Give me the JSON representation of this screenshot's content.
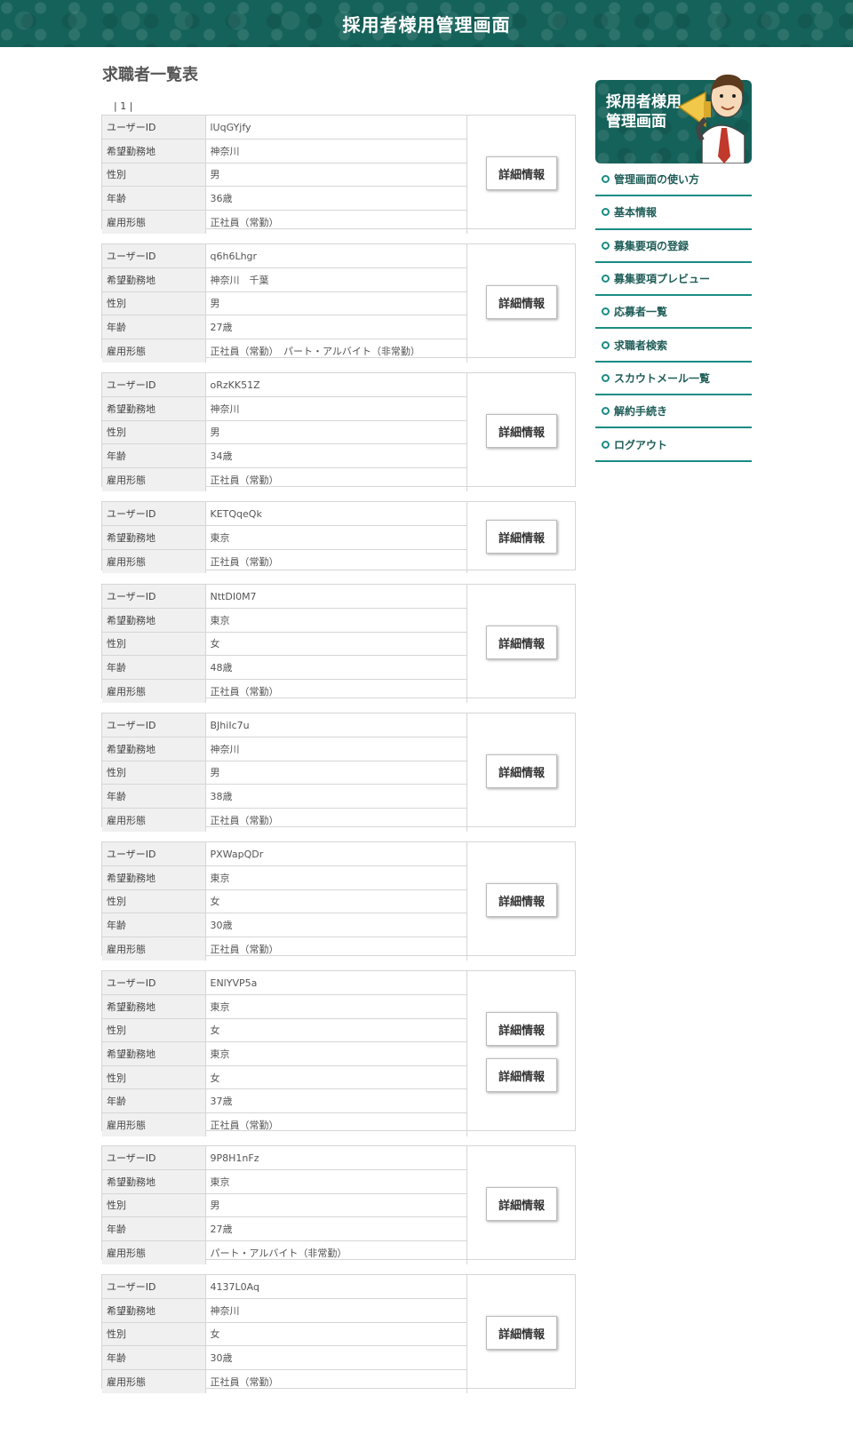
{
  "header": {
    "title": "採用者様用管理画面"
  },
  "page": {
    "heading": "求職者一覧表",
    "pagination": "| 1 |"
  },
  "detail_label": "詳細情報",
  "labels": {
    "user_id": "ユーザーID",
    "location": "希望勤務地",
    "gender": "性別",
    "age": "年齢",
    "employment": "雇用形態"
  },
  "cards": [
    {
      "rows": [
        [
          "ユーザーID",
          "lUqGYjfy"
        ],
        [
          "希望勤務地",
          "神奈川"
        ],
        [
          "性別",
          "男"
        ],
        [
          "年齢",
          "36歳"
        ],
        [
          "雇用形態",
          "正社員（常勤）"
        ]
      ]
    },
    {
      "rows": [
        [
          "ユーザーID",
          "q6h6Lhgr"
        ],
        [
          "希望勤務地",
          "神奈川　千葉"
        ],
        [
          "性別",
          "男"
        ],
        [
          "年齢",
          "27歳"
        ],
        [
          "雇用形態",
          "正社員（常勤）　パート・アルバイト（非常勤）"
        ]
      ]
    },
    {
      "rows": [
        [
          "ユーザーID",
          "oRzKK51Z"
        ],
        [
          "希望勤務地",
          "神奈川"
        ],
        [
          "性別",
          "男"
        ],
        [
          "年齢",
          "34歳"
        ],
        [
          "雇用形態",
          "正社員（常勤）"
        ]
      ]
    },
    {
      "rows": [
        [
          "ユーザーID",
          "KETQqeQk"
        ],
        [
          "希望勤務地",
          "東京"
        ],
        [
          "雇用形態",
          "正社員（常勤）"
        ]
      ]
    },
    {
      "rows": [
        [
          "ユーザーID",
          "NttDI0M7"
        ],
        [
          "希望勤務地",
          "東京"
        ],
        [
          "性別",
          "女"
        ],
        [
          "年齢",
          "48歳"
        ],
        [
          "雇用形態",
          "正社員（常勤）"
        ]
      ]
    },
    {
      "rows": [
        [
          "ユーザーID",
          "BJhiIc7u"
        ],
        [
          "希望勤務地",
          "神奈川"
        ],
        [
          "性別",
          "男"
        ],
        [
          "年齢",
          "38歳"
        ],
        [
          "雇用形態",
          "正社員（常勤）"
        ]
      ]
    },
    {
      "rows": [
        [
          "ユーザーID",
          "PXWapQDr"
        ],
        [
          "希望勤務地",
          "東京"
        ],
        [
          "性別",
          "女"
        ],
        [
          "年齢",
          "30歳"
        ],
        [
          "雇用形態",
          "正社員（常勤）"
        ]
      ]
    },
    {
      "rows": [
        [
          "ユーザーID",
          "ENlYVP5a"
        ],
        [
          "希望勤務地",
          "東京"
        ],
        [
          "性別",
          "女"
        ],
        [
          "希望勤務地",
          "東京"
        ],
        [
          "性別",
          "女"
        ],
        [
          "年齢",
          "37歳"
        ],
        [
          "雇用形態",
          "正社員（常勤）"
        ]
      ]
    },
    {
      "rows": [
        [
          "ユーザーID",
          "9P8H1nFz"
        ],
        [
          "希望勤務地",
          "東京"
        ],
        [
          "性別",
          "男"
        ],
        [
          "年齢",
          "27歳"
        ],
        [
          "雇用形態",
          "パート・アルバイト（非常勤）"
        ]
      ]
    },
    {
      "rows": [
        [
          "ユーザーID",
          "4137L0Aq"
        ],
        [
          "希望勤務地",
          "神奈川"
        ],
        [
          "性別",
          "女"
        ],
        [
          "年齢",
          "30歳"
        ],
        [
          "雇用形態",
          "正社員（常勤）"
        ]
      ]
    }
  ],
  "sidebar": {
    "banner_text": "採用者様用\n管理画面",
    "menu": [
      "管理画面の使い方",
      "基本情報",
      "募集要項の登録",
      "募集要項プレビュー",
      "応募者一覧",
      "求職者検索",
      "スカウトメール一覧",
      "解約手続き",
      "ログアウト"
    ]
  },
  "colors": {
    "header_bg": "#15625a",
    "accent": "#1a8c84"
  }
}
